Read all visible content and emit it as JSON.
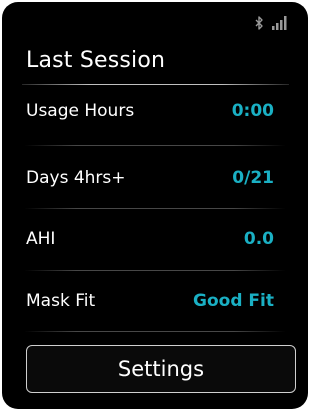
{
  "status_bar": {
    "bluetooth_icon": "bluetooth-icon",
    "signal_icon": "signal-strength-icon"
  },
  "page": {
    "title": "Last Session"
  },
  "stats": [
    {
      "label": "Usage Hours",
      "value": "0:00"
    },
    {
      "label": "Days 4hrs+",
      "value": "0/21"
    },
    {
      "label": "AHI",
      "value": "0.0"
    },
    {
      "label": "Mask Fit",
      "value": "Good Fit"
    }
  ],
  "actions": {
    "settings_label": "Settings"
  },
  "colors": {
    "background": "#000000",
    "accent": "#1ab0c4",
    "text": "#ffffff"
  }
}
